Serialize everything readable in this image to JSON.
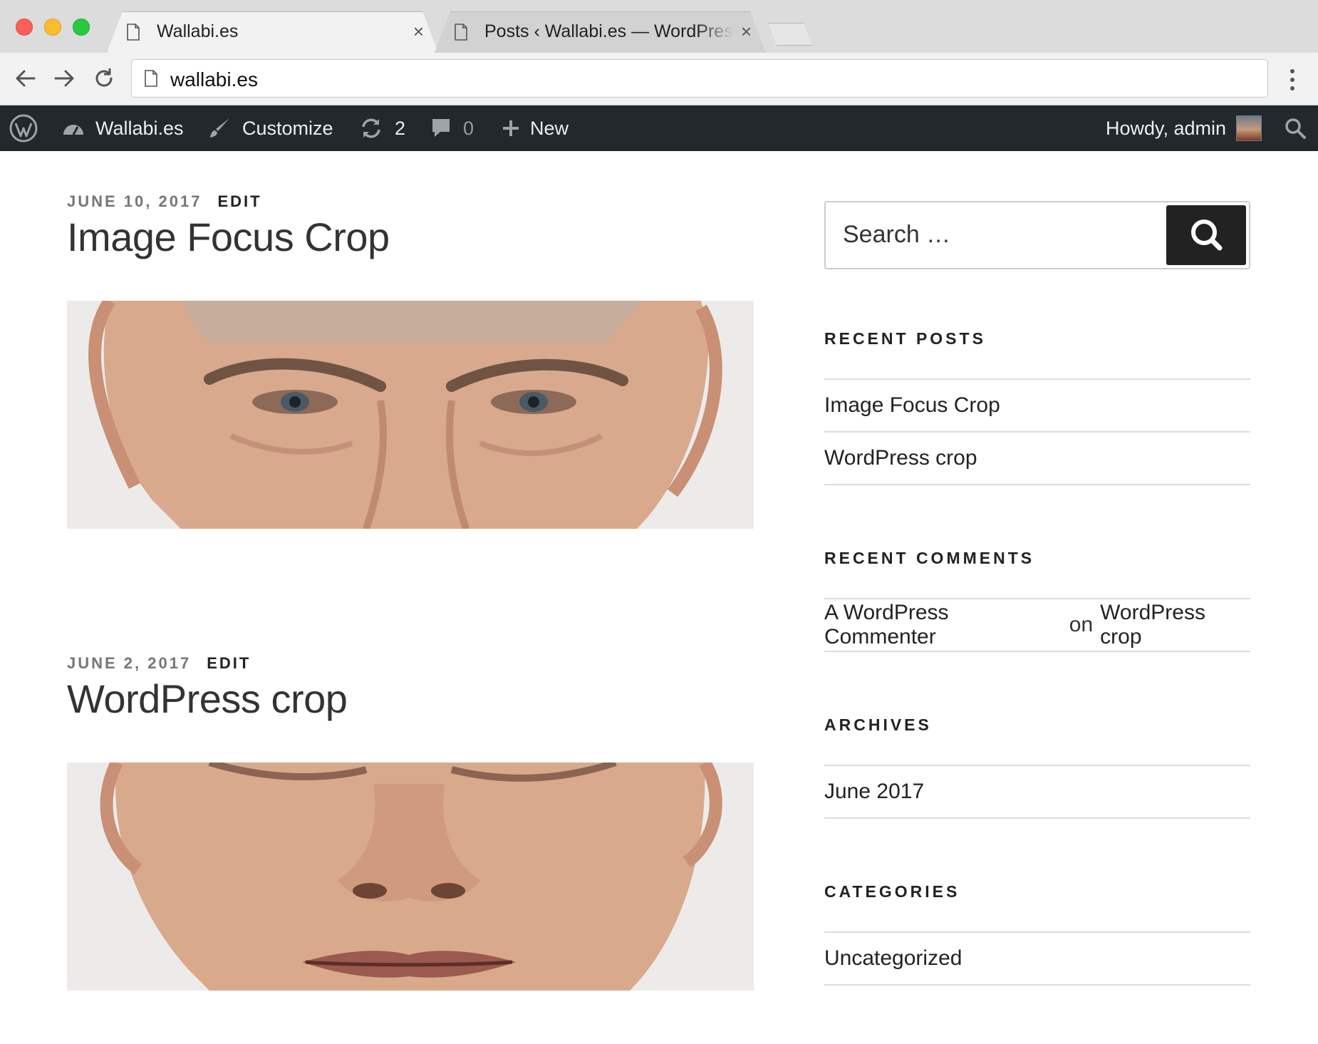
{
  "browser": {
    "tabs": [
      {
        "title": "Wallabi.es",
        "active": true
      },
      {
        "title": "Posts ‹ Wallabi.es — WordPress",
        "active": false
      }
    ],
    "close_glyph": "×",
    "url": "wallabi.es"
  },
  "adminbar": {
    "site_name": "Wallabi.es",
    "customize": "Customize",
    "updates_count": "2",
    "comments_count": "0",
    "new_label": "New",
    "howdy": "Howdy, admin"
  },
  "posts": [
    {
      "date": "June 10, 2017",
      "edit": "Edit",
      "title": "Image Focus Crop",
      "image": "face-eyes-crop"
    },
    {
      "date": "June 2, 2017",
      "edit": "Edit",
      "title": "WordPress crop",
      "image": "face-nose-mouth-crop"
    }
  ],
  "sidebar": {
    "search_placeholder": "Search …",
    "recent_posts": {
      "title": "Recent Posts",
      "items": [
        "Image Focus Crop",
        "WordPress crop"
      ]
    },
    "recent_comments": {
      "title": "Recent Comments",
      "author": "A WordPress Commenter",
      "on": "on",
      "post": "WordPress crop"
    },
    "archives": {
      "title": "Archives",
      "items": [
        "June 2017"
      ]
    },
    "categories": {
      "title": "Categories",
      "items": [
        "Uncategorized"
      ]
    }
  },
  "colors": {
    "adminbar_bg": "#23282d",
    "search_button": "#222222",
    "meta_gray": "#767676"
  }
}
